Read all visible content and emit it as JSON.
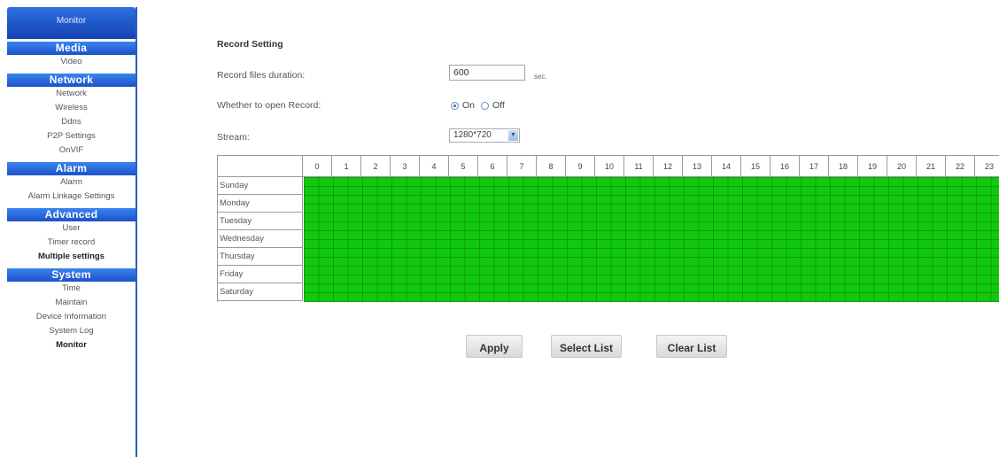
{
  "sidebar": {
    "top_label": "Monitor",
    "sections": [
      {
        "header": "Media",
        "items": [
          {
            "label": "Video"
          }
        ]
      },
      {
        "header": "Network",
        "items": [
          {
            "label": "Network"
          },
          {
            "label": "Wireless"
          },
          {
            "label": "Ddns"
          },
          {
            "label": "P2P Settings"
          },
          {
            "label": "OnVIF"
          }
        ]
      },
      {
        "header": "Alarm",
        "items": [
          {
            "label": "Alarm"
          },
          {
            "label": "Alarm Linkage Settings"
          }
        ]
      },
      {
        "header": "Advanced",
        "items": [
          {
            "label": "User"
          },
          {
            "label": "Timer record"
          },
          {
            "label": "Multiple settings"
          }
        ]
      },
      {
        "header": "System",
        "items": [
          {
            "label": "Time"
          },
          {
            "label": "Maintain"
          },
          {
            "label": "Device Information"
          },
          {
            "label": "System Log"
          },
          {
            "label": "Monitor"
          }
        ]
      }
    ]
  },
  "main": {
    "title": "Record Setting",
    "duration": {
      "label": "Record files duration:",
      "value": "600",
      "unit": "sec."
    },
    "open_record": {
      "label": "Whether to open Record:",
      "on_label": "On",
      "off_label": "Off",
      "selected": "On"
    },
    "stream": {
      "label": "Stream:",
      "value": "1280*720"
    },
    "schedule": {
      "hours": [
        "0",
        "1",
        "2",
        "3",
        "4",
        "5",
        "6",
        "7",
        "8",
        "9",
        "10",
        "11",
        "12",
        "13",
        "14",
        "15",
        "16",
        "17",
        "18",
        "19",
        "20",
        "21",
        "22",
        "23"
      ],
      "days": [
        "Sunday",
        "Monday",
        "Tuesday",
        "Wednesday",
        "Thursday",
        "Friday",
        "Saturday"
      ],
      "selected_color": "#11c80f"
    },
    "buttons": {
      "apply": "Apply",
      "select_list": "Select List",
      "clear_list": "Clear List"
    }
  }
}
